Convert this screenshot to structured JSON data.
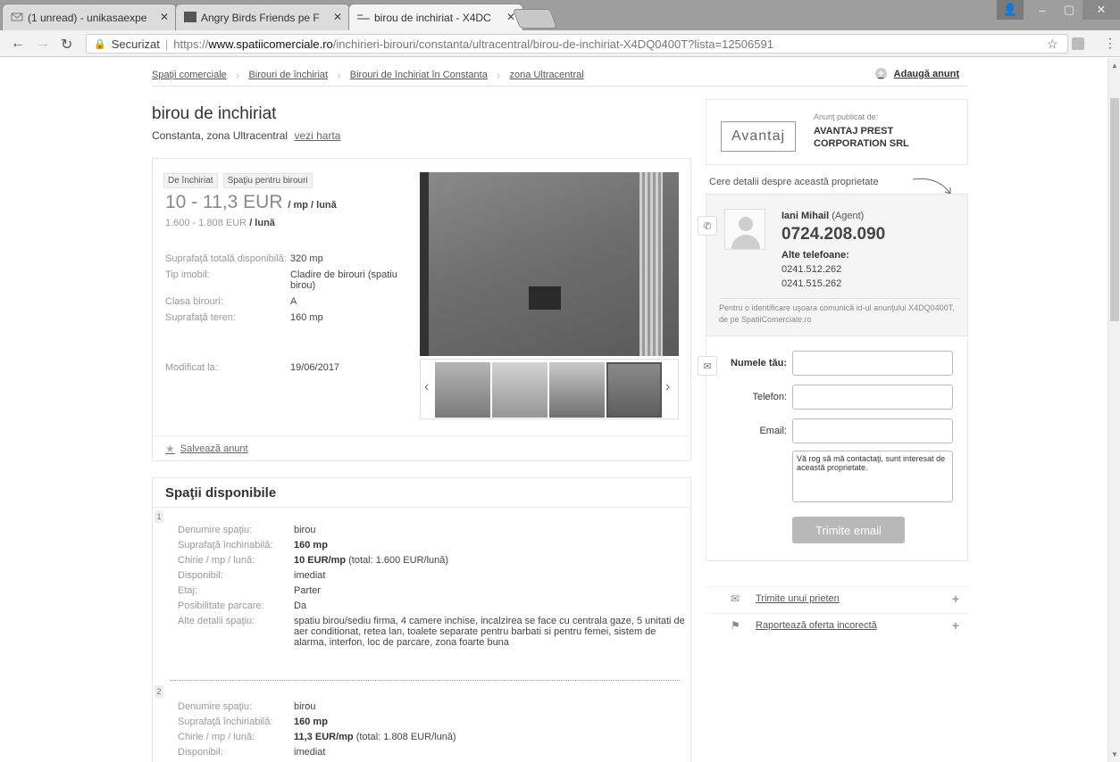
{
  "browser": {
    "tabs": [
      {
        "title": "(1 unread) - unikasaexpe"
      },
      {
        "title": "Angry Birds Friends pe F"
      },
      {
        "title": "birou de inchiriat - X4DC"
      }
    ],
    "address": {
      "secure_label": "Securizat",
      "protocol": "https://",
      "host": "www.spatiicomerciale.ro",
      "path": "/inchirieri-birouri/constanta/ultracentral/birou-de-inchiriat-X4DQ0400T?lista=12506591"
    }
  },
  "breadcrumb": [
    "Spaţii comerciale",
    "Birouri de închiriat",
    "Birouri de închiriat în Constanta",
    "zona Ultracentral"
  ],
  "add_ad": "Adaugă anunţ",
  "listing": {
    "title": "birou de inchiriat",
    "location": "Constanta, zona Ultracentral",
    "map_link": "vezi harta",
    "tags": [
      "De închiriat",
      "Spaţiu pentru birouri"
    ],
    "price_range": "10 - 11,3 EUR",
    "price_unit": "/ mp / lună",
    "total_range": "1.600 - 1.808 EUR",
    "total_unit": "/ lună",
    "specs": [
      {
        "k": "Suprafaţă totală disponibilă:",
        "v": "320 mp"
      },
      {
        "k": "Tip imobil:",
        "v": "Cladire de birouri (spatiu birou)"
      },
      {
        "k": "Clasa birouri:",
        "v": "A"
      },
      {
        "k": "Suprafaţă teren:",
        "v": "160 mp"
      }
    ],
    "modified_label": "Modificat la:",
    "modified_value": "19/06/2017",
    "save_ad": "Salvează anunt"
  },
  "spaces": {
    "title": "Spaţii disponibile",
    "items": [
      {
        "num": "1",
        "rows": [
          {
            "k": "Denumire spaţiu:",
            "v": "birou"
          },
          {
            "k": "Suprafaţă închiriabilă:",
            "v": "160 mp"
          },
          {
            "k": "Chirie / mp / lună:",
            "v": "10 EUR/mp",
            "extra": "(total: 1.600 EUR/lună)"
          },
          {
            "k": "Disponibil:",
            "v": "imediat"
          },
          {
            "k": "Etaj:",
            "v": "Parter"
          },
          {
            "k": "Posibilitate parcare:",
            "v": "Da"
          },
          {
            "k": "Alte detalii spaţiu:",
            "v": "spatiu birou/sediu firma, 4 camere inchise, incalzirea se face cu centrala gaze, 5 unitati de aer conditionat, retea lan, toalete separate pentru barbati si pentru femei, sistem de alarma, interfon, loc de parcare, zona foarte buna"
          }
        ]
      },
      {
        "num": "2",
        "rows": [
          {
            "k": "Denumire spaţiu:",
            "v": "birou"
          },
          {
            "k": "Suprafaţă închiriabilă:",
            "v": "160 mp"
          },
          {
            "k": "Chirie / mp / lună:",
            "v": "11,3 EUR/mp",
            "extra": "(total: 1.808 EUR/lună)"
          },
          {
            "k": "Disponibil:",
            "v": "imediat"
          }
        ]
      }
    ]
  },
  "agency": {
    "logo_text": "Avantaj",
    "published_by": "Anunţ publicat de:",
    "name": "AVANTAJ PREST CORPORATION SRL"
  },
  "contact": {
    "ask_details": "Cere detalii despre această proprietate",
    "agent_name": "Iani Mihail",
    "agent_role": "(Agent)",
    "phone": "0724.208.090",
    "other_phones_label": "Alte telefoane:",
    "other_phones": [
      "0241.512.262",
      "0241.515.262"
    ],
    "id_note": "Pentru o identificare uşoara comunică id-ul anunţului X4DQ0400T, de pe SpatiiComerciale.ro"
  },
  "form": {
    "name_label": "Numele tău:",
    "phone_label": "Telefon:",
    "email_label": "Email:",
    "message": "Vă rog să mă contactaţi, sunt interesat de această proprietate.",
    "send_button": "Trimite email"
  },
  "links": {
    "send_friend": "Trimite unui prieten",
    "report": "Raportează oferta incorectă"
  }
}
